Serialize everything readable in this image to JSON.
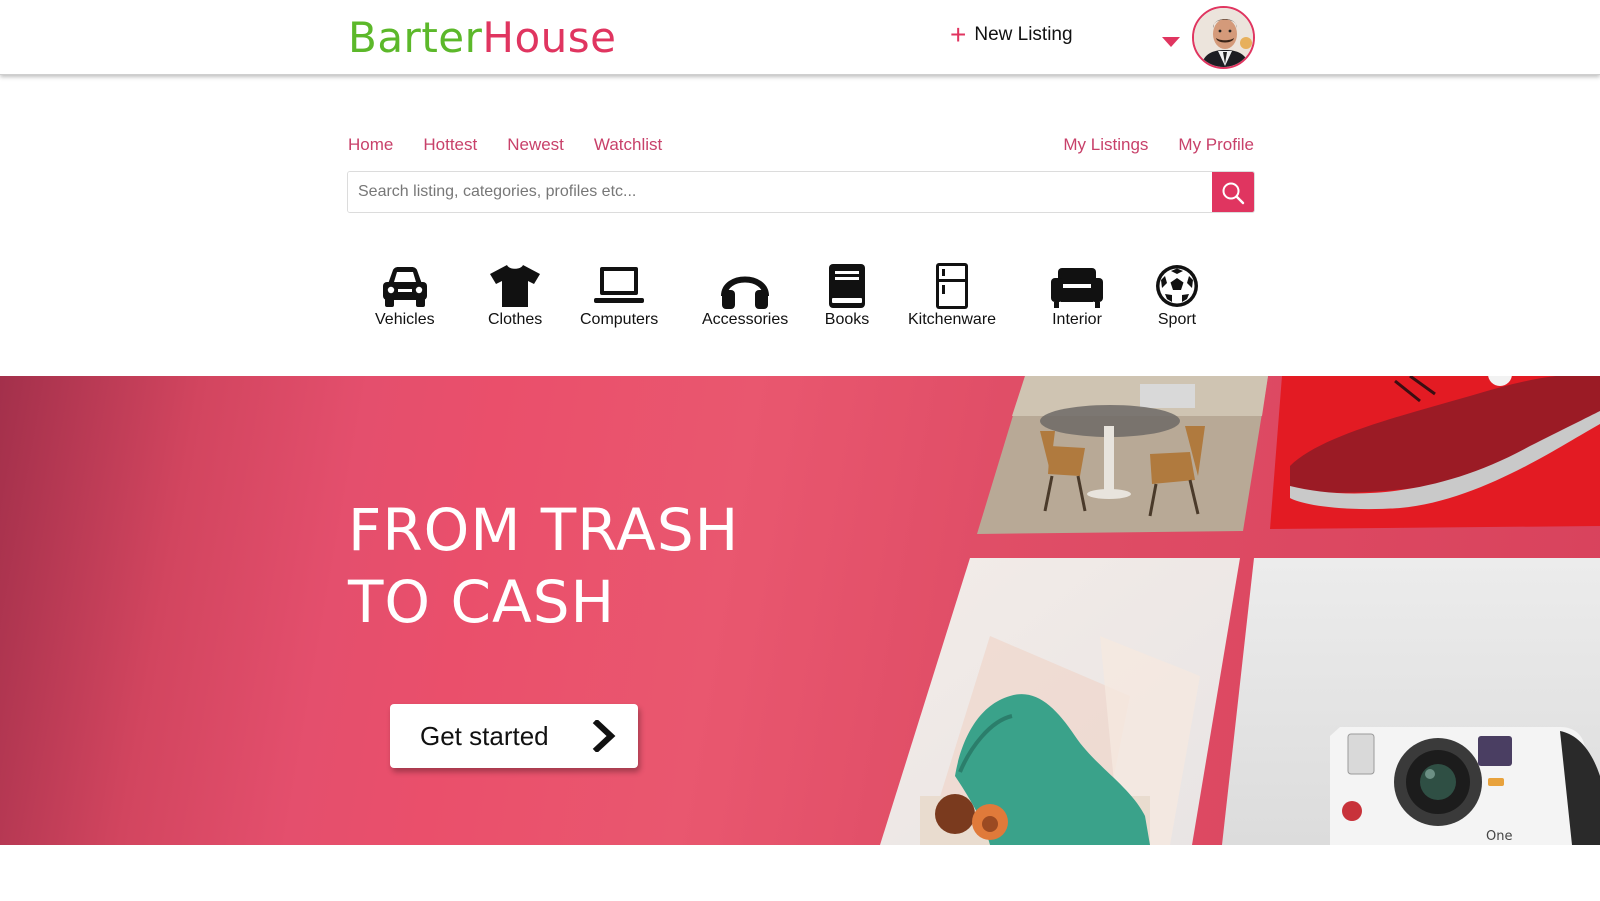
{
  "header": {
    "logo_part1": "Barter",
    "logo_part2": "House",
    "new_listing_label": "New Listing"
  },
  "nav": {
    "left": [
      "Home",
      "Hottest",
      "Newest",
      "Watchlist"
    ],
    "right": [
      "My Listings",
      "My Profile"
    ]
  },
  "search": {
    "placeholder": "Search listing, categories, profiles etc..."
  },
  "categories": [
    "Vehicles",
    "Clothes",
    "Computers",
    "Accessories",
    "Books",
    "Kitchenware",
    "Interior",
    "Sport"
  ],
  "hero": {
    "title": "FROM TRASH\nTO CASH",
    "cta_label": "Get started",
    "camera_text": "One"
  },
  "colors": {
    "accent": "#e03560",
    "logo_green": "#5cb82a",
    "nav_link": "#c8416a"
  }
}
